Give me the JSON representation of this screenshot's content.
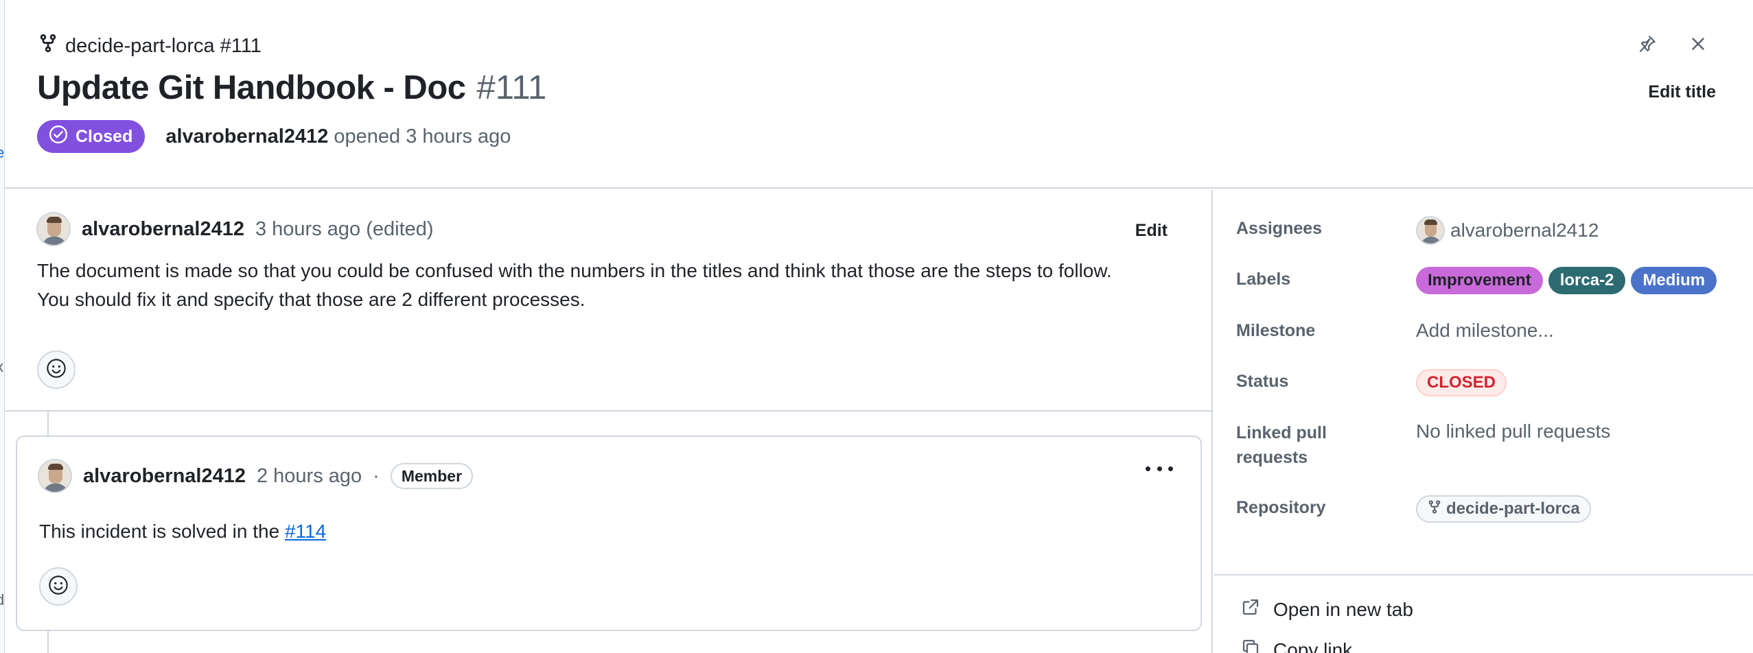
{
  "header": {
    "repo_ref": "decide-part-lorca #111",
    "title": "Update Git Handbook - Doc",
    "number": "#111",
    "state": "Closed",
    "author": "alvarobernal2412",
    "opened_text": "opened 3 hours ago",
    "edit_title_label": "Edit title",
    "icons": [
      "git-fork-icon",
      "pin-icon",
      "close-icon",
      "check-circle-icon"
    ]
  },
  "comments": [
    {
      "author": "alvarobernal2412",
      "time": "3 hours ago (edited)",
      "edit_label": "Edit",
      "body_line1": "The document is made so that you could be confused with the numbers in the titles and think that those are the steps to follow.",
      "body_line2": "You should fix it and specify that those are 2 different processes."
    },
    {
      "author": "alvarobernal2412",
      "time": "2 hours ago",
      "separator": "·",
      "role": "Member",
      "body_text": "This incident is solved in the ",
      "body_link": "#114"
    }
  ],
  "sidebar": {
    "assignees_label": "Assignees",
    "assignee": "alvarobernal2412",
    "labels_label": "Labels",
    "labels": [
      {
        "name": "Improvement",
        "color": "#c86ad9",
        "text_color": "#1f2328"
      },
      {
        "name": "lorca-2",
        "color": "#2d6b72",
        "text_color": "#ffffff"
      },
      {
        "name": "Medium",
        "color": "#4a73c9",
        "text_color": "#ffffff"
      }
    ],
    "milestone_label": "Milestone",
    "milestone_value": "Add milestone...",
    "status_label": "Status",
    "status_value": "CLOSED",
    "linked_label_line1": "Linked pull",
    "linked_label_line2": "requests",
    "linked_value": "No linked pull requests",
    "repository_label": "Repository",
    "repository_value": "decide-part-lorca",
    "actions": {
      "open_new_tab": "Open in new tab",
      "copy_link": "Copy link"
    }
  },
  "colors": {
    "closed_purple": "#8250df",
    "link_blue": "#0969da",
    "closed_red": "#d1242f",
    "border": "#d0d7de"
  }
}
